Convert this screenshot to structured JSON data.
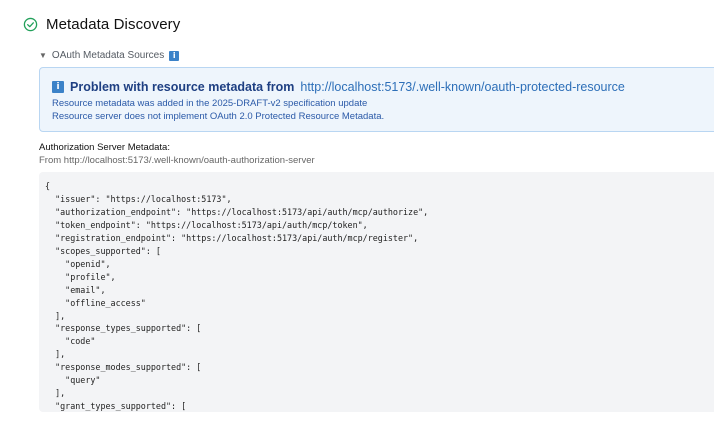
{
  "header": {
    "title": "Metadata Discovery",
    "status": "success"
  },
  "sources": {
    "label": "OAuth Metadata Sources",
    "info_glyph": "i"
  },
  "alert": {
    "title_strong": "Problem with resource metadata from",
    "title_link": "http://localhost:5173/.well-known/oauth-protected-resource",
    "line1_prefix": "Resource metadata was added in the",
    "line1_link": "2025-DRAFT-v2 specification update",
    "line2": "Resource server does not implement OAuth 2.0 Protected Resource Metadata."
  },
  "auth_server": {
    "label": "Authorization Server Metadata:",
    "from": "From http://localhost:5173/.well-known/oauth-authorization-server"
  },
  "code": "{\n  \"issuer\": \"https://localhost:5173\",\n  \"authorization_endpoint\": \"https://localhost:5173/api/auth/mcp/authorize\",\n  \"token_endpoint\": \"https://localhost:5173/api/auth/mcp/token\",\n  \"registration_endpoint\": \"https://localhost:5173/api/auth/mcp/register\",\n  \"scopes_supported\": [\n    \"openid\",\n    \"profile\",\n    \"email\",\n    \"offline_access\"\n  ],\n  \"response_types_supported\": [\n    \"code\"\n  ],\n  \"response_modes_supported\": [\n    \"query\"\n  ],\n  \"grant_types_supported\": ["
}
